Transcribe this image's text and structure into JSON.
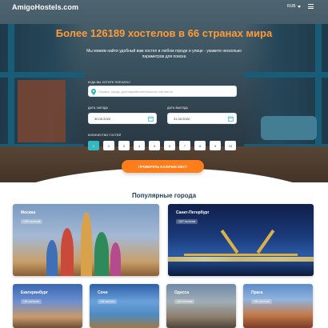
{
  "header": {
    "logo": "AmigoHostels.com",
    "language": "RUB"
  },
  "hero": {
    "headline": "Более 126189 хостелов в 66 странах мира",
    "subtitle": "Мы можем найти удобный вам хостел в любом городе и улице - укажите несколько параметров для поиска"
  },
  "search": {
    "destination_label": "Куда вы хотите поехать?",
    "destination_placeholder": "Страна, город, достопримечательность или место",
    "checkin_label": "Дата заезда",
    "checkin_value": "30.05.2020",
    "checkout_label": "Дата выезда",
    "checkout_value": "31.05.2020",
    "guests_label": "Количество гостей",
    "guests": [
      "1",
      "2",
      "3",
      "4",
      "5",
      "6",
      "7",
      "8",
      "9",
      "10"
    ],
    "submit_label": "Проверить наличие мест"
  },
  "popular": {
    "title": "Популярные города",
    "cities": [
      {
        "name": "Москва",
        "count": "1496 хостелов"
      },
      {
        "name": "Санкт-Петербург",
        "count": "1187 хостелов"
      },
      {
        "name": "Екатеринбург",
        "count": "136 хостелов"
      },
      {
        "name": "Сочи",
        "count": "144 хостела"
      },
      {
        "name": "Одесса",
        "count": "118 хостелов"
      },
      {
        "name": "Прага",
        "count": "195 хостелов"
      }
    ]
  },
  "colors": {
    "accent": "#ff9b38",
    "button": "#ff7d1a",
    "active_guest": "#35b8c2",
    "title": "#1d3c50"
  }
}
